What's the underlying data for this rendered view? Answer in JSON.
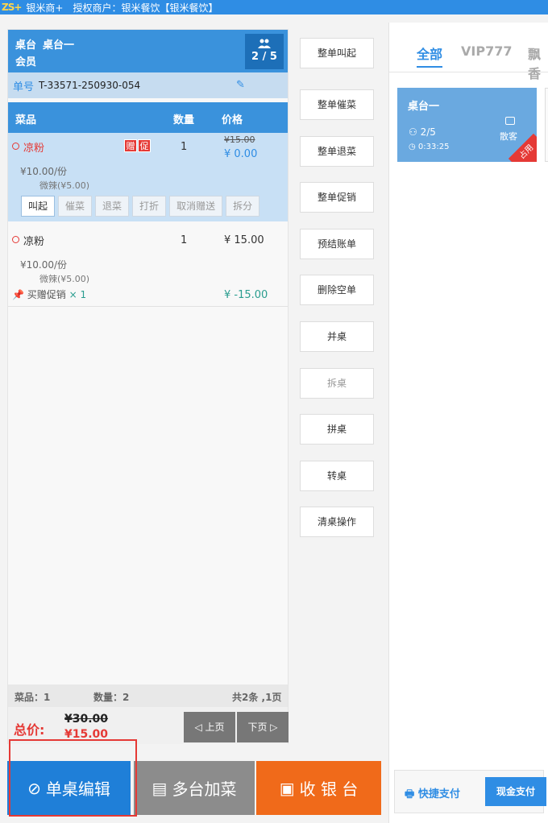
{
  "topbar": {
    "logo": "ZS+",
    "app": "银米商+",
    "merchant": "授权商户：银米餐饮【银米餐饮】"
  },
  "table": {
    "label": "桌台",
    "name": "桌台一",
    "member_label": "会员",
    "guests": "2 / 5"
  },
  "order": {
    "label": "单号",
    "number": "T-33571-250930-054"
  },
  "columns": {
    "dish": "菜品",
    "qty": "数量",
    "price": "价格"
  },
  "items": [
    {
      "name": "凉粉",
      "tags": [
        "赠",
        "促"
      ],
      "qty": "1",
      "orig_price": "¥15.00",
      "price": "¥ 0.00",
      "unit_price": "¥10.00/份",
      "spec": "微辣(¥5.00)",
      "ops": [
        "叫起",
        "催菜",
        "退菜",
        "打折",
        "取消赠送",
        "拆分"
      ]
    },
    {
      "name": "凉粉",
      "qty": "1",
      "price": "¥ 15.00",
      "unit_price": "¥10.00/份",
      "spec": "微辣(¥5.00)",
      "promo": {
        "label": "买赠促销",
        "mult": "× 1",
        "price": "¥  -15.00"
      }
    }
  ],
  "summary": {
    "dish_count": "菜品：1",
    "qty_count": "数量：2",
    "pages": "共2条 ,1页"
  },
  "total": {
    "label": "总价:",
    "old": "¥30.00",
    "new": "¥15.00"
  },
  "pager": {
    "prev": "上页",
    "next": "下页"
  },
  "mid_buttons": [
    "整单叫起",
    "整单催菜",
    "整单退菜",
    "整单促销",
    "预结账单",
    "删除空单",
    "并桌",
    "拆桌",
    "拼桌",
    "转桌",
    "清桌操作"
  ],
  "tabs": [
    "全部",
    "VIP777",
    "飘香"
  ],
  "card": {
    "name": "桌台一",
    "guests": "2/5",
    "time": "0:33:25",
    "type": "散客",
    "status": "占用"
  },
  "pay": {
    "quick": "快捷支付",
    "cash": "现金支付"
  },
  "actions": {
    "single_edit": "单桌编辑",
    "multi_add": "多台加菜",
    "cashier": "收 银 台"
  }
}
